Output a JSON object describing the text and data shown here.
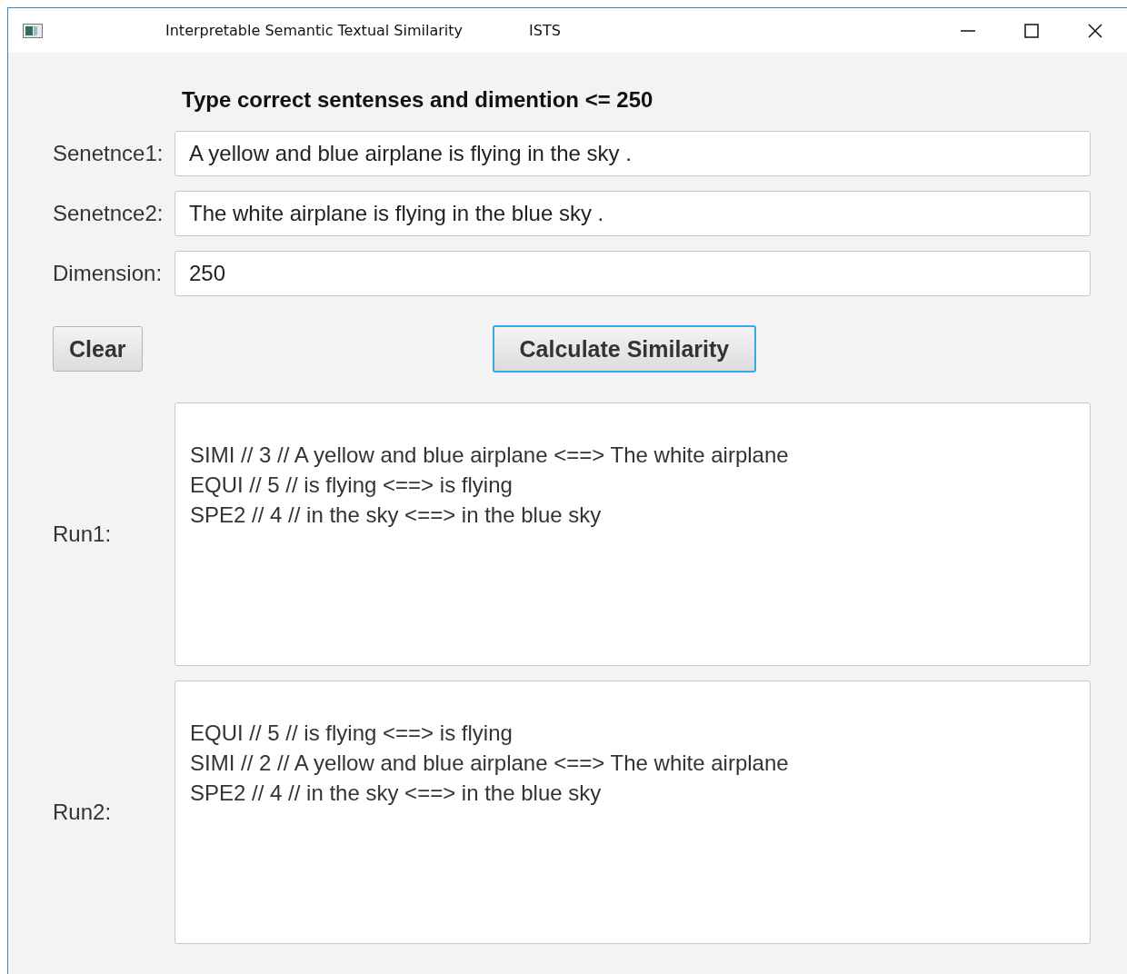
{
  "window": {
    "title": "Interpretable Semantic Textual Similarity",
    "subtitle": "ISTS"
  },
  "heading": "Type correct sentenses and dimention <= 250",
  "fields": [
    {
      "label": "Senetnce1:",
      "value": "A yellow and blue airplane is flying in the sky ."
    },
    {
      "label": "Senetnce2:",
      "value": "The white airplane is flying in the blue sky ."
    },
    {
      "label": "Dimension:",
      "value": "250"
    }
  ],
  "buttons": [
    {
      "label": "Clear",
      "focused": false
    },
    {
      "label": "Calculate Similarity",
      "focused": true
    }
  ],
  "runs": [
    {
      "label": "Run1:",
      "lines": [
        "SIMI // 3 // A yellow and blue airplane <==> The white airplane",
        "EQUI // 5 // is flying <==> is flying",
        "SPE2 // 4 // in the sky <==> in the blue sky"
      ]
    },
    {
      "label": "Run2:",
      "lines": [
        "EQUI // 5 // is flying <==> is flying",
        "SIMI // 2 // A yellow and blue airplane <==> The white airplane",
        "SPE2 // 4 // in the sky <==> in the blue sky"
      ]
    }
  ]
}
